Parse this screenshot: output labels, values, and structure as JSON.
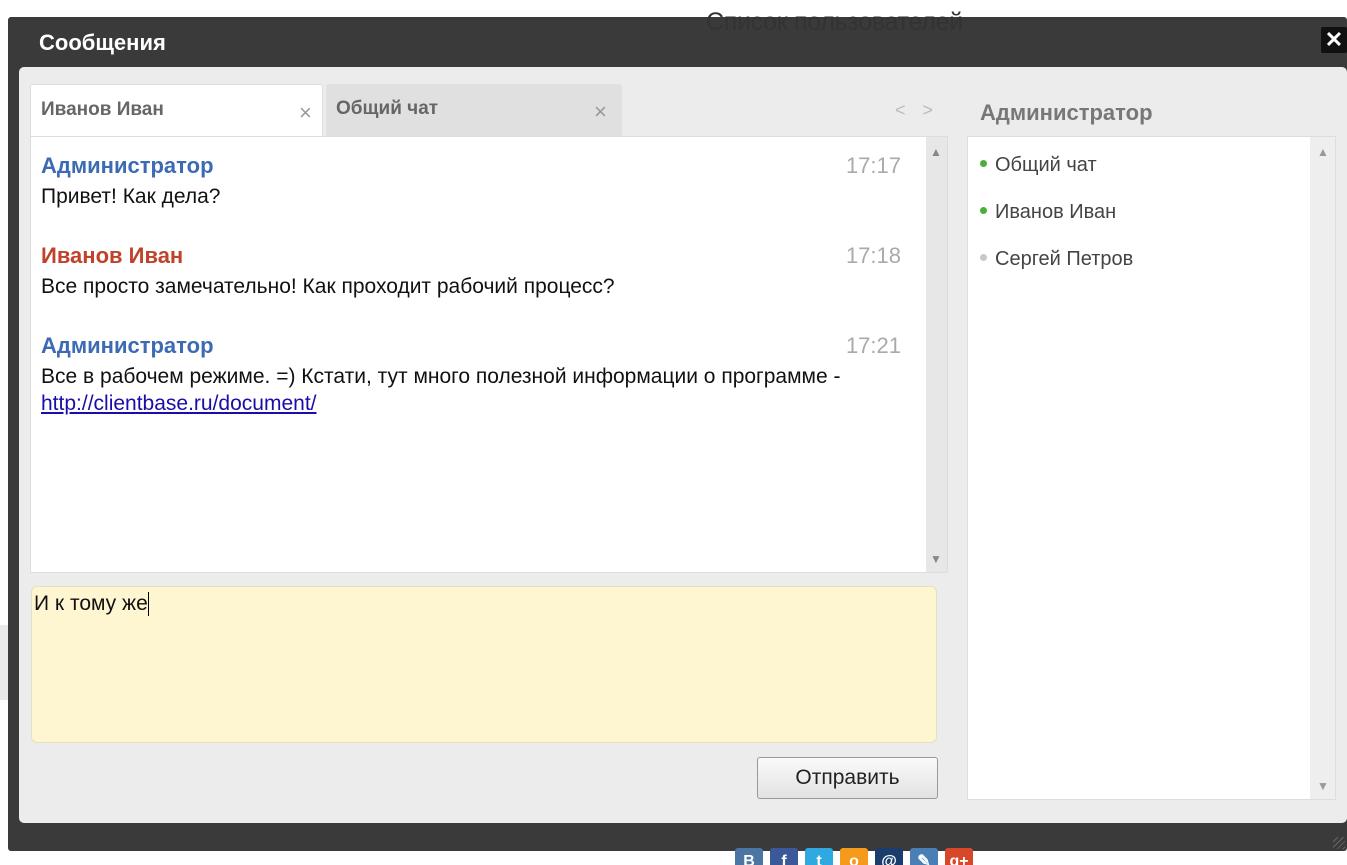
{
  "overlay_title": "Список пользователей",
  "dialog": {
    "title": "Сообщения",
    "close_icon": "✕"
  },
  "tabs": [
    {
      "label": "Иванов Иван",
      "close": "×",
      "active": true
    },
    {
      "label": "Общий чат",
      "close": "×",
      "active": false
    }
  ],
  "tab_nav": "< >",
  "messages": [
    {
      "author": "Администратор",
      "time": "17:17",
      "text": "Привет! Как дела?",
      "role": "admin"
    },
    {
      "author": "Иванов Иван",
      "time": "17:18",
      "text": "Все просто замечательно! Как проходит рабочий процесс?",
      "role": "user"
    },
    {
      "author": "Администратор",
      "time": "17:21",
      "text_before_link": "Все в рабочем режиме. =) Кстати, тут много полезной информации о программе - ",
      "link": "http://clientbase.ru/document/",
      "role": "admin"
    }
  ],
  "input": {
    "value": "И к тому же"
  },
  "send_button": "Отправить",
  "users_panel": {
    "title": "Администратор",
    "users": [
      {
        "name": "Общий чат",
        "status": "online"
      },
      {
        "name": "Иванов Иван",
        "status": "online"
      },
      {
        "name": "Сергей Петров",
        "status": "offline"
      }
    ]
  },
  "social_icons": [
    {
      "icon": "vk-icon",
      "glyph": "B",
      "color": "#4c75a3"
    },
    {
      "icon": "facebook-icon",
      "glyph": "f",
      "color": "#3b5998"
    },
    {
      "icon": "twitter-icon",
      "glyph": "t",
      "color": "#2fa9e0"
    },
    {
      "icon": "odnoklassniki-icon",
      "glyph": "о",
      "color": "#f59a1a"
    },
    {
      "icon": "mailru-icon",
      "glyph": "@",
      "color": "#1a3d6e"
    },
    {
      "icon": "livejournal-icon",
      "glyph": "✎",
      "color": "#4a7fb5"
    },
    {
      "icon": "googleplus-icon",
      "glyph": "g+",
      "color": "#d9472b"
    }
  ],
  "colors": {
    "online": "#4caf3a",
    "offline": "#c8c8c8",
    "admin": "#3c6bb4",
    "user": "#c0422a"
  }
}
